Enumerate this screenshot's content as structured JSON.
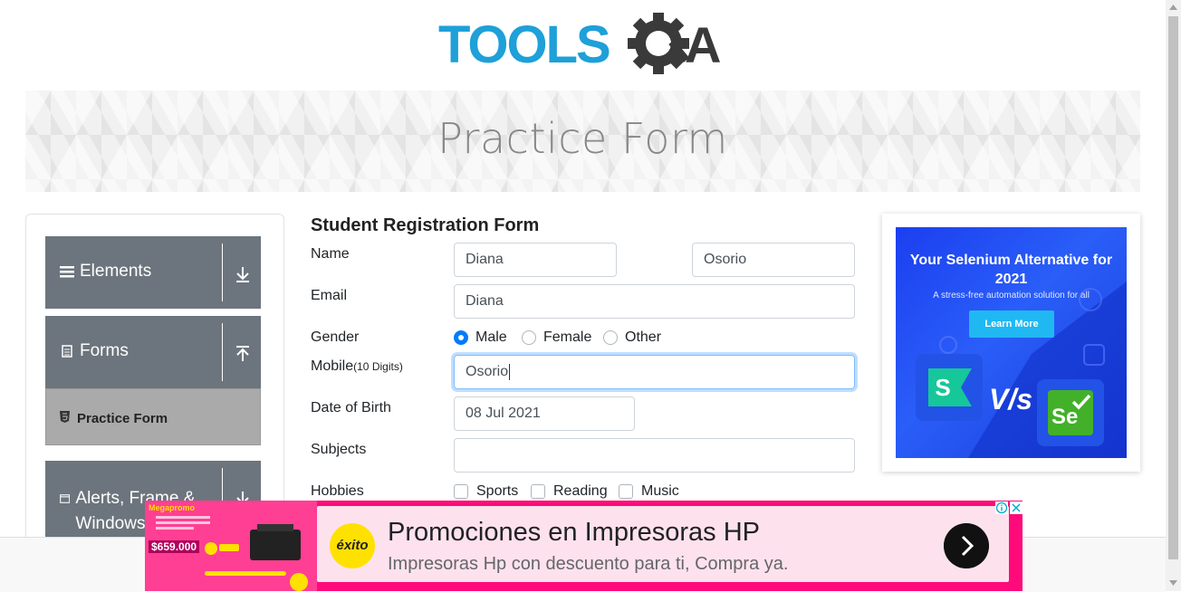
{
  "header": {
    "logo_text": "TOOLSQA",
    "banner_title": "Practice Form"
  },
  "sidebar": {
    "groups": [
      {
        "label": "Elements"
      },
      {
        "label": "Forms"
      },
      {
        "label": "Alerts, Frame & Windows"
      }
    ],
    "active_item": "Practice Form"
  },
  "form": {
    "title": "Student Registration Form",
    "labels": {
      "name": "Name",
      "email": "Email",
      "gender": "Gender",
      "mobile": "Mobile",
      "mobile_hint": "(10 Digits)",
      "dob": "Date of Birth",
      "subjects": "Subjects",
      "hobbies": "Hobbies"
    },
    "first_name": "Diana",
    "last_name": "Osorio",
    "email": "Diana",
    "mobile": "Osorio",
    "dob": "08 Jul 2021",
    "subjects": "",
    "gender_options": [
      "Male",
      "Female",
      "Other"
    ],
    "gender_selected": "Male",
    "hobbies": [
      "Sports",
      "Reading",
      "Music"
    ]
  },
  "right_ad": {
    "headline": "Your Selenium Alternative for 2021",
    "subline": "A stress-free automation solution for all",
    "button": "Learn More",
    "vs": "V/s",
    "left_logo": "S",
    "right_logo": "Se",
    "bg_color": "#2a5ef8"
  },
  "bottom_ad": {
    "title": "Promociones en Impresoras HP",
    "subtitle": "Impresoras Hp con descuento para ti, Compra ya.",
    "brand": "éxito",
    "promo_tag": "Megapromo",
    "promo_price": "$659.000",
    "accent_color": "#ff0a7a"
  }
}
